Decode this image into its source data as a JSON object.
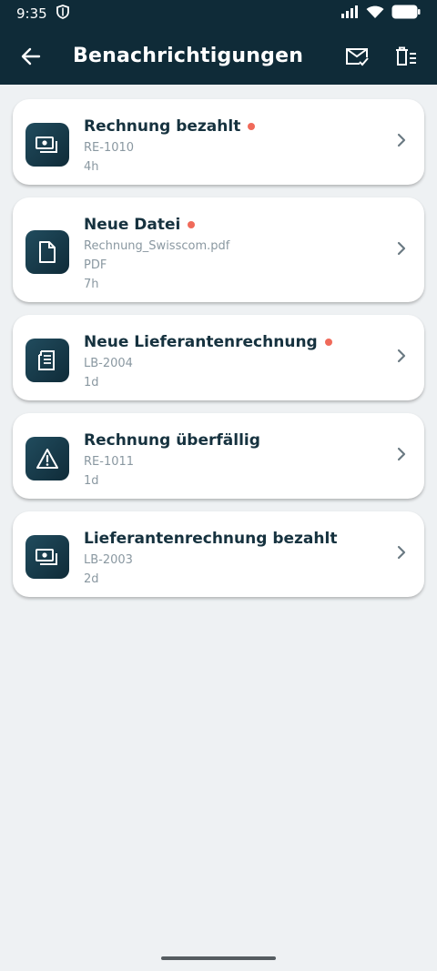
{
  "status": {
    "time": "9:35"
  },
  "header": {
    "title": "Benachrichtigungen",
    "back_icon": "arrow-left-icon",
    "mark_read_icon": "mail-check-icon",
    "delete_icon": "delete-all-icon"
  },
  "colors": {
    "header_bg": "#0f2b38",
    "unread_dot": "#f06a5a",
    "background": "#eef1f3"
  },
  "notifications": [
    {
      "title": "Rechnung bezahlt",
      "lines": [
        "RE-1010",
        "4h"
      ],
      "unread": true,
      "icon": "payment-icon"
    },
    {
      "title": "Neue Datei",
      "lines": [
        "Rechnung_Swisscom.pdf",
        "PDF",
        "7h"
      ],
      "unread": true,
      "icon": "file-icon"
    },
    {
      "title": "Neue Lieferantenrechnung",
      "lines": [
        "LB-2004",
        "1d"
      ],
      "unread": true,
      "icon": "receipt-icon"
    },
    {
      "title": "Rechnung überfällig",
      "lines": [
        "RE-1011",
        "1d"
      ],
      "unread": false,
      "icon": "warning-icon"
    },
    {
      "title": "Lieferantenrechnung bezahlt",
      "lines": [
        "LB-2003",
        "2d"
      ],
      "unread": false,
      "icon": "payment-icon"
    }
  ]
}
